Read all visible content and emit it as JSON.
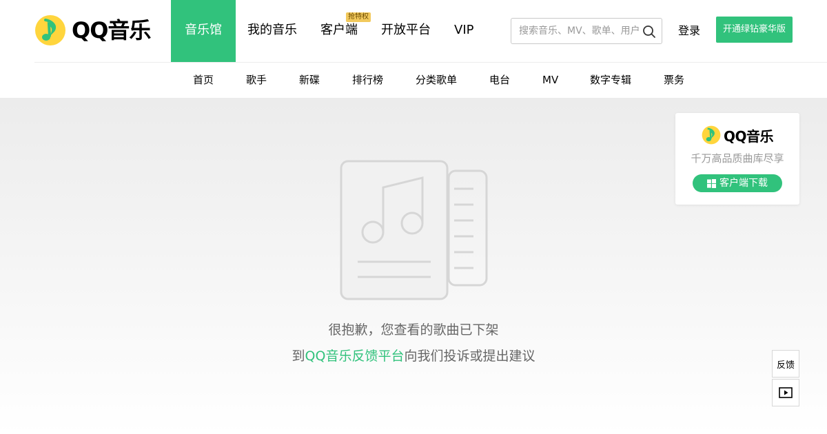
{
  "brand": {
    "name": "QQ音乐",
    "accent": "#31c27c",
    "logo_yellow": "#ffd53d",
    "icon": "qq-music-note-icon"
  },
  "main_nav": [
    {
      "label": "音乐馆",
      "active": true
    },
    {
      "label": "我的音乐",
      "active": false
    },
    {
      "label": "客户端",
      "active": false,
      "tag": "抢特权"
    },
    {
      "label": "开放平台",
      "active": false
    },
    {
      "label": "VIP",
      "active": false
    }
  ],
  "search": {
    "placeholder": "搜索音乐、MV、歌单、用户",
    "icon": "search-icon"
  },
  "login_label": "登录",
  "vip_button": "开通绿钻豪华版",
  "sub_nav": [
    "首页",
    "歌手",
    "新碟",
    "排行榜",
    "分类歌单",
    "电台",
    "MV",
    "数字专辑",
    "票务"
  ],
  "message": {
    "line1": "很抱歉，您查看的歌曲已下架",
    "line2_prefix": "到",
    "line2_link": "QQ音乐反馈平台",
    "line2_suffix": "向我们投诉或提出建议"
  },
  "promo": {
    "logo": "QQ音乐",
    "tagline": "千万高品质曲库尽享",
    "button": "客户端下载",
    "button_icon": "windows-icon"
  },
  "side_tools": {
    "feedback": "反馈",
    "video_icon": "play-box-icon"
  }
}
